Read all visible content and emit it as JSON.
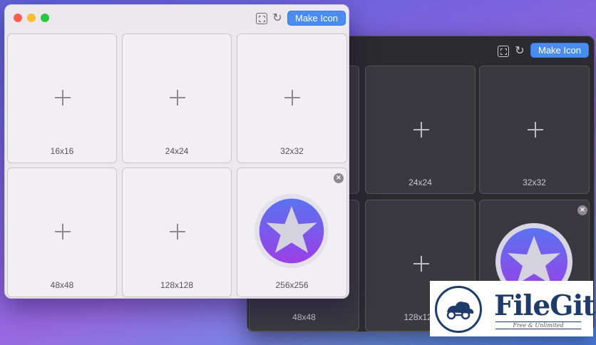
{
  "dark_window": {
    "make_icon_label": "Make Icon",
    "cells": [
      {
        "label": ""
      },
      {
        "label": "24x24"
      },
      {
        "label": "32x32"
      },
      {
        "label": "48x48"
      },
      {
        "label": "128x128"
      }
    ]
  },
  "light_window": {
    "make_icon_label": "Make Icon",
    "cells": [
      {
        "label": "16x16"
      },
      {
        "label": "24x24"
      },
      {
        "label": "32x32"
      },
      {
        "label": "48x48"
      },
      {
        "label": "128x128"
      },
      {
        "label": "256x256"
      }
    ]
  },
  "icons": {
    "fit": "expand-icon",
    "refresh": "refresh-icon",
    "remove": "close-circle-icon",
    "preview": "star-app-icon"
  },
  "colors": {
    "accent": "#4a8cf0",
    "traffic_red": "#fe5f57",
    "traffic_yellow": "#febc2e",
    "traffic_green": "#28c840"
  },
  "watermark": {
    "name": "FileGit",
    "tagline": "Free & Unlimited"
  }
}
